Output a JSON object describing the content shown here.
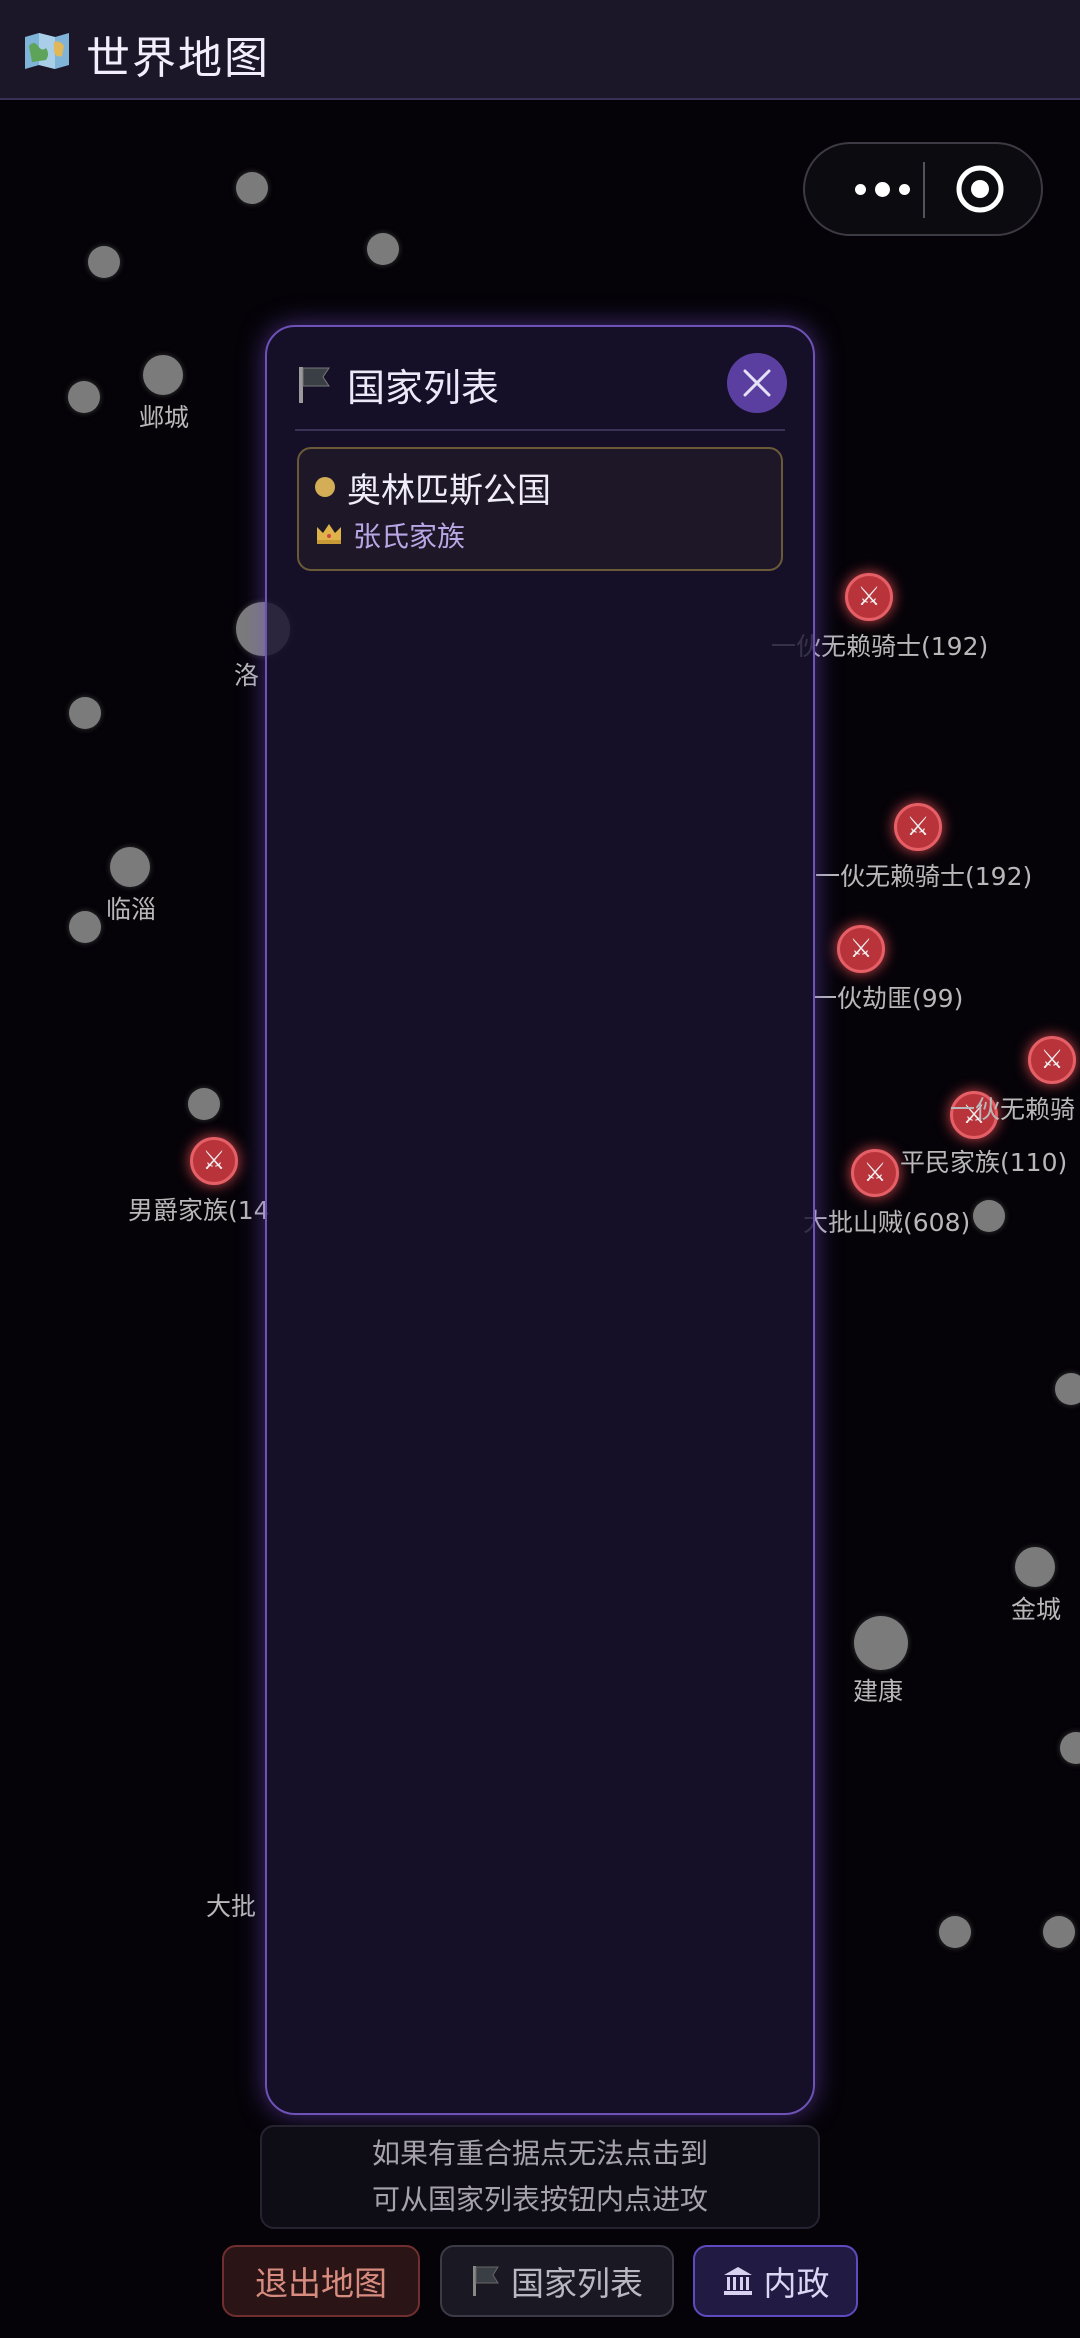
{
  "header": {
    "title": "世界地图",
    "icon": "map-icon"
  },
  "capsule": {
    "menu_icon": "more-dots-icon",
    "close_icon": "target-icon"
  },
  "map": {
    "labels": [
      {
        "text": "邺城",
        "name": "city-label-yecheng"
      },
      {
        "text": "洛",
        "name": "city-label-luoyang"
      },
      {
        "text": "临淄",
        "name": "city-label-linzi"
      },
      {
        "text": "金城",
        "name": "city-label-jincheng"
      },
      {
        "text": "建康",
        "name": "city-label-jiankang"
      },
      {
        "text": "一伙无赖骑士(192)",
        "name": "enemy-label-1"
      },
      {
        "text": "一伙无赖骑士(192)",
        "name": "enemy-label-2"
      },
      {
        "text": "一伙劫匪(99)",
        "name": "enemy-label-3"
      },
      {
        "text": "一伙无赖骑",
        "name": "enemy-label-4"
      },
      {
        "text": "平民家族(110)",
        "name": "enemy-label-5"
      },
      {
        "text": "大批山贼(608)",
        "name": "enemy-label-6"
      },
      {
        "text": "男爵家族(14",
        "name": "enemy-label-7"
      },
      {
        "text": "大批",
        "name": "enemy-label-8"
      }
    ]
  },
  "modal": {
    "title": "国家列表",
    "flag_icon": "flag-icon",
    "close_icon": "close-icon",
    "countries": [
      {
        "name": "奥林匹斯公国",
        "ruler": "张氏家族",
        "dot_color": "#d3ae57"
      }
    ]
  },
  "tip": {
    "line1": "如果有重合据点无法点击到",
    "line2": "可从国家列表按钮内点进攻"
  },
  "buttons": {
    "exit": "退出地图",
    "list": "国家列表",
    "gov": "内政"
  },
  "colors": {
    "accent": "#5a3fa0",
    "enemy": "#b9333b",
    "gold": "#d3ae57"
  }
}
